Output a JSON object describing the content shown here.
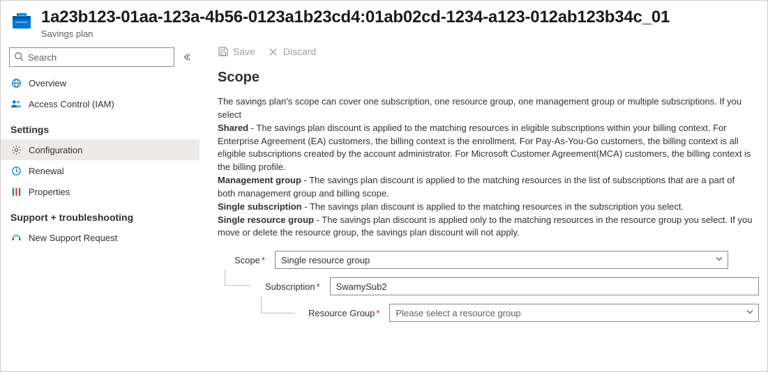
{
  "header": {
    "title": "1a23b123-01aa-123a-4b56-0123a1b23cd4:01ab02cd-1234-a123-012ab123b34c_01",
    "subtitle": "Savings plan"
  },
  "sidebar": {
    "search_placeholder": "Search",
    "items": [
      {
        "label": "Overview"
      },
      {
        "label": "Access Control (IAM)"
      }
    ],
    "settings_header": "Settings",
    "settings_items": [
      {
        "label": "Configuration"
      },
      {
        "label": "Renewal"
      },
      {
        "label": "Properties"
      }
    ],
    "support_header": "Support + troubleshooting",
    "support_items": [
      {
        "label": "New Support Request"
      }
    ]
  },
  "toolbar": {
    "save_label": "Save",
    "discard_label": "Discard"
  },
  "main": {
    "title": "Scope",
    "intro": "The savings plan's scope can cover one subscription, one resource group, one management group or multiple subscriptions. If you select",
    "shared_bold": "Shared",
    "shared_text": " - The savings plan discount is applied to the matching resources in eligible subscriptions within your billing context. For Enterprise Agreement (EA) customers, the billing context is the enrollment. For Pay-As-You-Go customers, the billing context is all eligible subscriptions created by the account administrator. For Microsoft Customer Agreement(MCA) customers, the billing context is the billing profile.",
    "mg_bold": "Management group",
    "mg_text": " - The savings plan discount is applied to the matching resources in the list of subscriptions that are a part of both management group and billing scope.",
    "single_sub_bold": "Single subscription",
    "single_sub_text": " - The savings plan discount is applied to the matching resources in the subscription you select.",
    "single_rg_bold": "Single resource group",
    "single_rg_text": " - The savings plan discount is applied only to the matching resources in the resource group you select. If you move or delete the resource group, the savings plan discount will not apply."
  },
  "form": {
    "scope_label": "Scope",
    "scope_value": "Single resource group",
    "subscription_label": "Subscription",
    "subscription_value": "SwamySub2",
    "rg_label": "Resource Group",
    "rg_placeholder": "Please select a resource group"
  }
}
